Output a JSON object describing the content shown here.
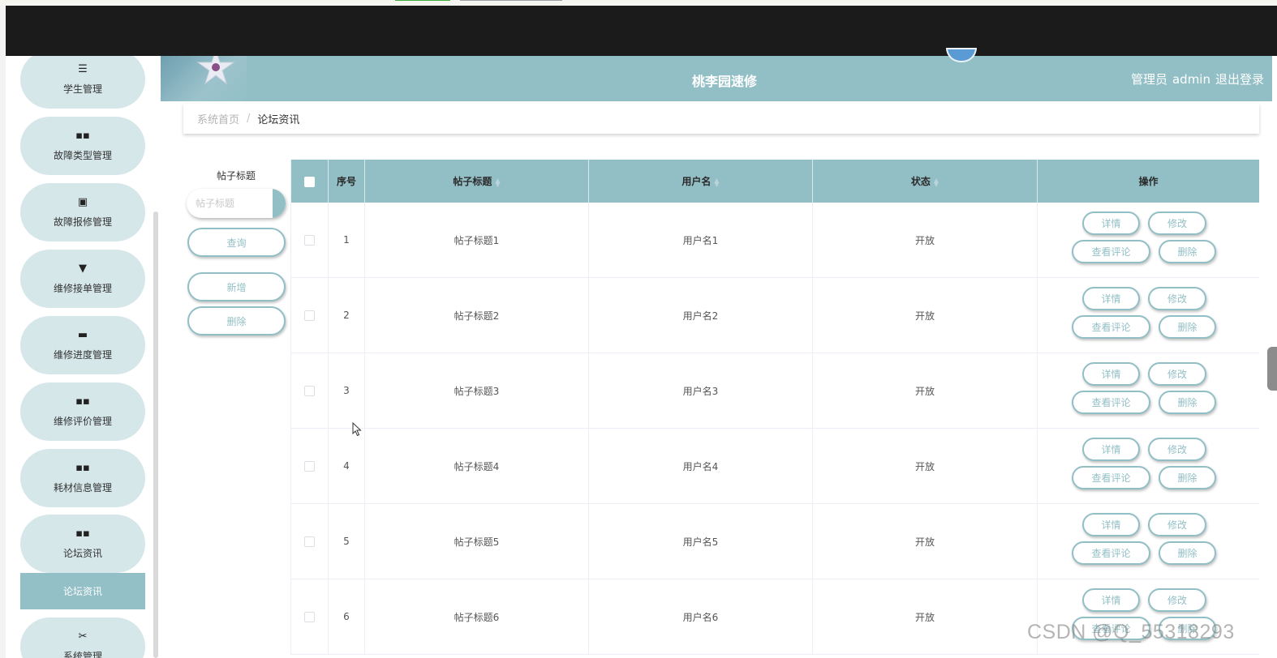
{
  "header": {
    "title": "桃李园速修",
    "user_role": "管理员",
    "username": "admin",
    "logout_label": "退出登录"
  },
  "sidebar": {
    "items": [
      {
        "label": "学生管理",
        "icon": "list-icon",
        "glyph": "☰"
      },
      {
        "label": "故障类型管理",
        "icon": "grid-icon",
        "glyph": "▪▪"
      },
      {
        "label": "故障报修管理",
        "icon": "clipboard-icon",
        "glyph": "▣"
      },
      {
        "label": "维修接单管理",
        "icon": "paint-roller-icon",
        "glyph": "▼"
      },
      {
        "label": "维修进度管理",
        "icon": "briefcase-icon",
        "glyph": "▬"
      },
      {
        "label": "维修评价管理",
        "icon": "grid-icon",
        "glyph": "▪▪"
      },
      {
        "label": "耗材信息管理",
        "icon": "grid-icon",
        "glyph": "▪▪"
      },
      {
        "label": "论坛资讯",
        "icon": "grid-icon",
        "glyph": "▪▪"
      },
      {
        "label": "系统管理",
        "icon": "ticket-icon",
        "glyph": "✂"
      }
    ],
    "active_sub": "论坛资讯"
  },
  "breadcrumb": {
    "home": "系统首页",
    "separator": "/",
    "current": "论坛资讯"
  },
  "search": {
    "label": "帖子标题",
    "placeholder": "帖子标题",
    "value": "",
    "query_button": "查询",
    "add_button": "新增",
    "delete_button": "删除"
  },
  "table": {
    "columns": [
      "序号",
      "帖子标题",
      "用户名",
      "状态",
      "操作"
    ],
    "rows": [
      {
        "no": "1",
        "title": "帖子标题1",
        "user": "用户名1",
        "status": "开放"
      },
      {
        "no": "2",
        "title": "帖子标题2",
        "user": "用户名2",
        "status": "开放"
      },
      {
        "no": "3",
        "title": "帖子标题3",
        "user": "用户名3",
        "status": "开放"
      },
      {
        "no": "4",
        "title": "帖子标题4",
        "user": "用户名4",
        "status": "开放"
      },
      {
        "no": "5",
        "title": "帖子标题5",
        "user": "用户名5",
        "status": "开放"
      },
      {
        "no": "6",
        "title": "帖子标题6",
        "user": "用户名6",
        "status": "开放"
      }
    ],
    "actions": {
      "detail": "详情",
      "edit": "修改",
      "view_comments": "查看评论",
      "delete": "删除"
    }
  },
  "watermark": "CSDN @Q_55318293",
  "colors": {
    "accent": "#92bfc6",
    "sidebar_item_bg": "#d6e7ea",
    "top_bar": "#1b1b1b"
  }
}
